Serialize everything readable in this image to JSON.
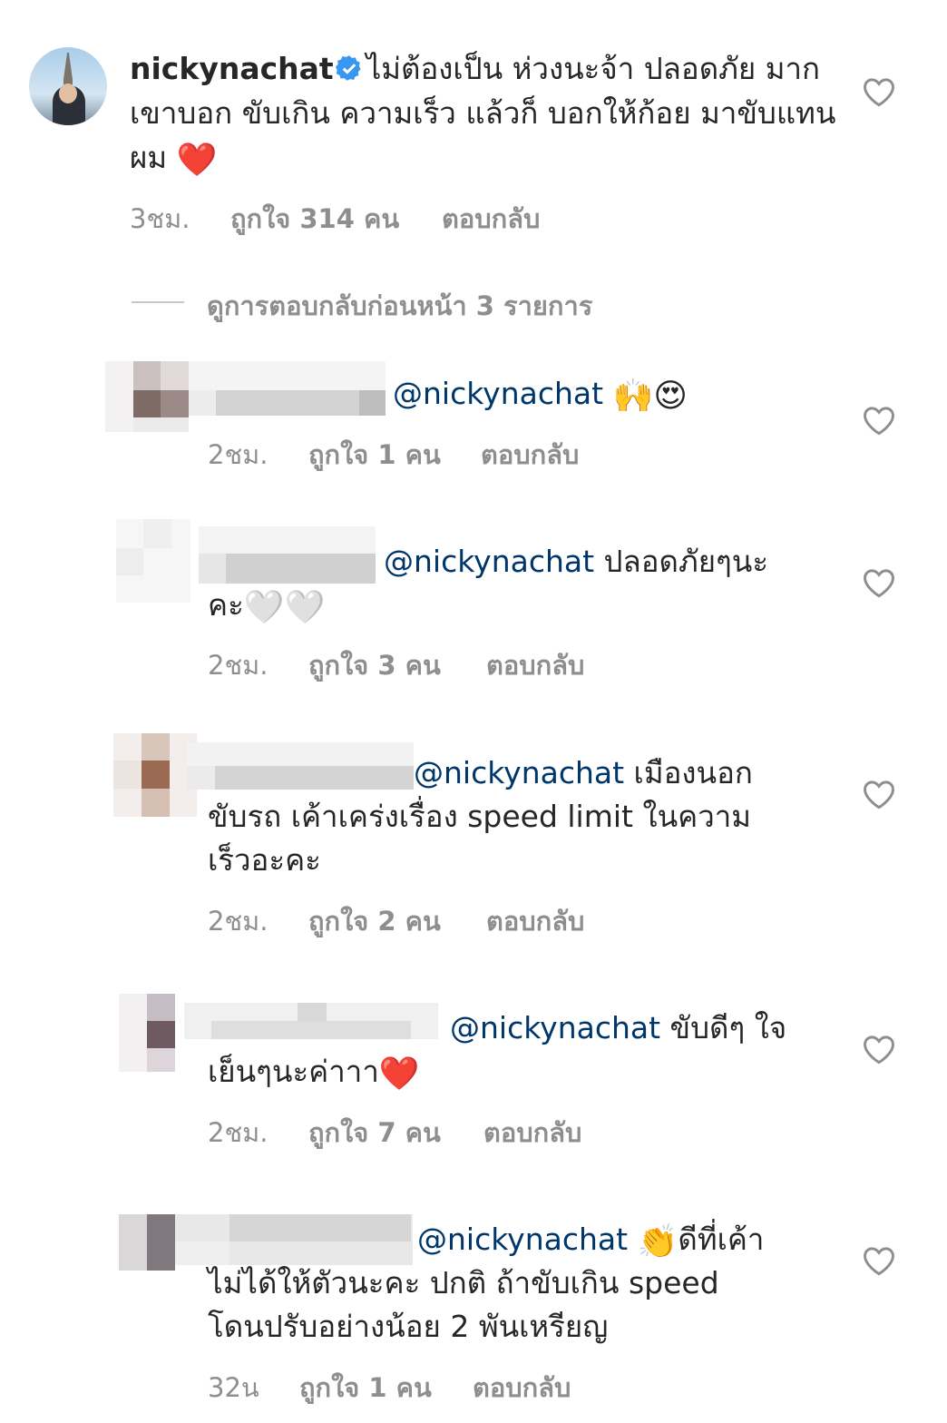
{
  "main_comment": {
    "username": "nickynachat",
    "text": "ไม่ต้องเป็น ห่วงนะจ้า ปลอดภัย มาก เขาบอก ขับเกิน ความเร็ว แล้วก็ บอกให้ก้อย มาขับแทนผม",
    "emoji": "❤️",
    "time": "3ชม.",
    "likes": "ถูกใจ 314 คน",
    "reply": "ตอบกลับ"
  },
  "view_replies": "ดูการตอบกลับก่อนหน้า 3 รายการ",
  "replies": [
    {
      "mention": "@nickynachat",
      "text": "",
      "emoji": "🙌😍",
      "time": "2ชม.",
      "likes": "ถูกใจ 1 คน",
      "reply": "ตอบกลับ"
    },
    {
      "mention": "@nickynachat",
      "text": " ปลอดภัยๆนะ",
      "line2": "คะ",
      "emoji": "🤍🤍",
      "time": "2ชม.",
      "likes": "ถูกใจ 3 คน",
      "reply": "ตอบกลับ"
    },
    {
      "mention": "@nickynachat",
      "text": " เมืองนอก",
      "line2": "ขับรถ เค้าเคร่งเรื่อง speed limit ในความ",
      "line3": "เร็วอะคะ",
      "time": "2ชม.",
      "likes": "ถูกใจ 2 คน",
      "reply": "ตอบกลับ"
    },
    {
      "mention": "@nickynachat",
      "text": " ขับดีๆ ใจ",
      "line2": "เย็นๆนะค่าาา",
      "emoji": "❤️",
      "time": "2ชม.",
      "likes": "ถูกใจ 7 คน",
      "reply": "ตอบกลับ"
    },
    {
      "mention": "@nickynachat",
      "emoji": "👏",
      "text": "ดีที่เค้า",
      "line2": "ไม่ได้ให้ตัวนะคะ ปกติ ถ้าขับเกิน speed",
      "line3": "โดนปรับอย่างน้อย 2 พันเหรียญ",
      "time": "32น",
      "likes": "ถูกใจ 1 คน",
      "reply": "ตอบกลับ"
    }
  ],
  "icons": {
    "heart": "heart-outline-icon",
    "verified": "verified-badge-icon"
  },
  "colors": {
    "text": "#262626",
    "secondary": "#8e8e8e",
    "mention": "#00376b",
    "verified": "#3897f0"
  }
}
